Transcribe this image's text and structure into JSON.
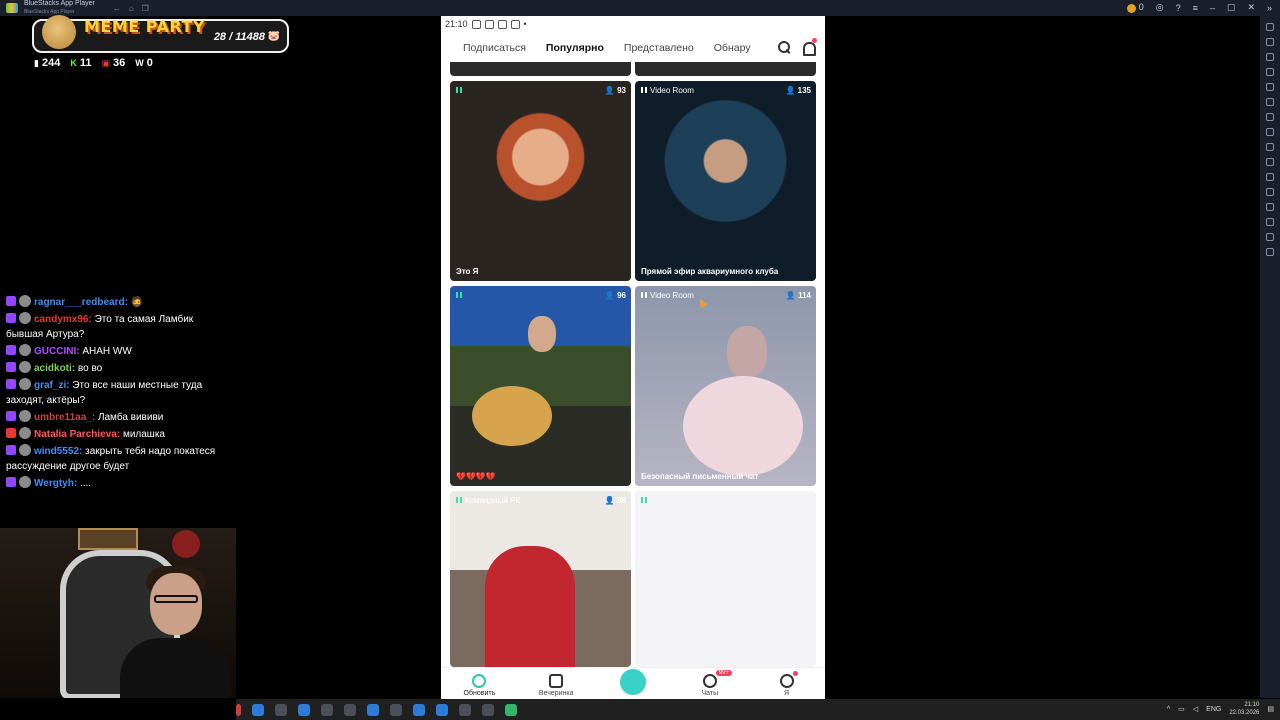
{
  "window": {
    "app_title": "BlueStacks App Player",
    "subtitle": "BlueStacks App Player",
    "coin_count": "0"
  },
  "overlay": {
    "meme_title": "MEME PARTY",
    "meme_count": "28 / 11488",
    "stats": [
      {
        "icon": "chat-icon",
        "value": "244"
      },
      {
        "icon": "kick-icon",
        "value": "11"
      },
      {
        "icon": "live-icon",
        "value": "36"
      },
      {
        "icon": "w-icon",
        "value": "0"
      }
    ]
  },
  "chat": [
    {
      "user": "ragnar___redbeard:",
      "text": "",
      "color": "#3e8ef7"
    },
    {
      "user": "candymx96:",
      "text": "Это та самая Ламбик бывшая Артура?",
      "color": "#e53935"
    },
    {
      "user": "GUCCINI:",
      "text": "АНАН WW",
      "color": "#b04dff"
    },
    {
      "user": "acidkoti:",
      "text": "во во",
      "color": "#7dd34a"
    },
    {
      "user": "graf_zi:",
      "text": "Это все наши местные туда заходят, актёры?",
      "color": "#3e8ef7"
    },
    {
      "user": "umbre11aa_:",
      "text": "Ламба вививи",
      "color": "#d43f3f"
    },
    {
      "user": "Natalia Parchieva:",
      "text": "милашка",
      "color": "#ff5a5a"
    },
    {
      "user": "wind5552:",
      "text": "закрыть тебя надо покатеся рассуждение другое будет",
      "color": "#3e8ef7"
    },
    {
      "user": "Wergtyh:",
      "text": "....",
      "color": "#3e8ef7"
    }
  ],
  "phone": {
    "time": "21:10",
    "tabs": [
      "Подписаться",
      "Популярно",
      "Представлено",
      "Обнару"
    ],
    "active_tab": "Популярно",
    "cards": [
      {
        "label": "",
        "viewers": "93",
        "caption": "Это Я"
      },
      {
        "label": "Video Room",
        "viewers": "135",
        "caption": "Прямой эфир аквариумного клуба"
      },
      {
        "label": "",
        "viewers": "96",
        "caption": "💔💔💔💔"
      },
      {
        "label": "Video Room",
        "viewers": "114",
        "caption": "Безопасный письменный чат"
      },
      {
        "label": "Командный РК",
        "viewers": "88",
        "caption": ""
      },
      {
        "label": "",
        "viewers": "",
        "caption": ""
      }
    ],
    "nav": [
      {
        "label": "Обновить",
        "icon": "refresh-icon"
      },
      {
        "label": "Вечеринка",
        "icon": "party-icon"
      },
      {
        "label": "",
        "icon": "camera-icon"
      },
      {
        "label": "Чаты",
        "icon": "chat-icon",
        "badge": "99+"
      },
      {
        "label": "Я",
        "icon": "profile-icon"
      }
    ]
  },
  "taskbar": {
    "lang": "ENG",
    "time": "21:10",
    "date": "22.03.2026"
  }
}
